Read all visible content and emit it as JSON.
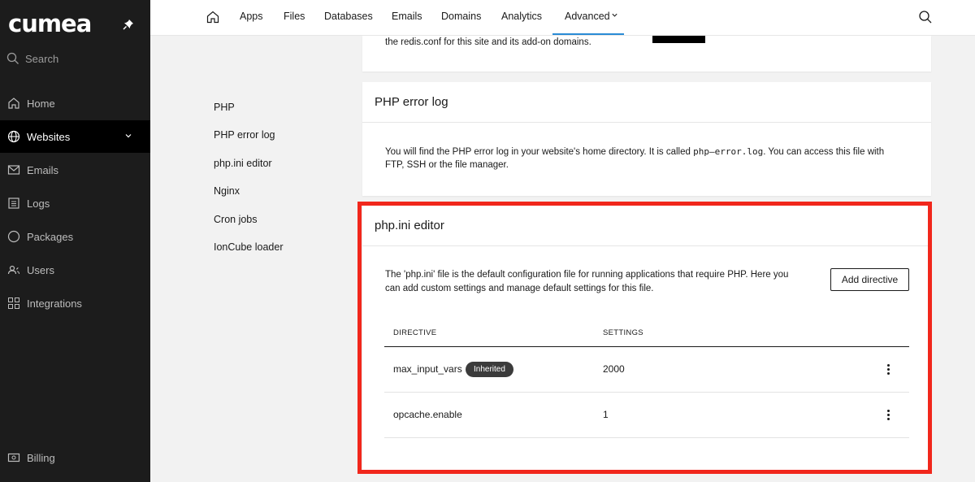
{
  "app": {
    "logo": "cumea"
  },
  "sidebar": {
    "search_label": "Search",
    "items": [
      {
        "label": "Home",
        "icon": "home-icon"
      },
      {
        "label": "Websites",
        "icon": "globe-icon",
        "active": true
      },
      {
        "label": "Emails",
        "icon": "mail-icon"
      },
      {
        "label": "Logs",
        "icon": "logs-icon"
      },
      {
        "label": "Packages",
        "icon": "circle-icon"
      },
      {
        "label": "Users",
        "icon": "users-icon"
      },
      {
        "label": "Integrations",
        "icon": "grid-icon"
      }
    ],
    "billing_label": "Billing"
  },
  "topnav": {
    "links": [
      "Apps",
      "Files",
      "Databases",
      "Emails",
      "Domains",
      "Analytics"
    ],
    "advanced_label": "Advanced"
  },
  "subnav": {
    "items": [
      "PHP",
      "PHP error log",
      "php.ini editor",
      "Nginx",
      "Cron jobs",
      "IonCube loader"
    ]
  },
  "redis_card": {
    "text": "the redis.conf for this site and its add-on domains."
  },
  "error_log_card": {
    "title": "PHP error log",
    "text_before": "You will find the PHP error log in your website's home directory. It is called ",
    "filename": "php–error.log",
    "text_after": ". You can access this file with",
    "text_line2": "FTP, SSH or the file manager."
  },
  "php_ini_card": {
    "title": "php.ini editor",
    "description_line1": "The 'php.ini' file is the default configuration file for running applications that require PHP. Here you",
    "description_line2": "can add custom settings and manage default settings for this file.",
    "add_button": "Add directive",
    "columns": {
      "directive": "DIRECTIVE",
      "settings": "SETTINGS"
    },
    "rows": [
      {
        "directive": "max_input_vars",
        "badge": "Inherited",
        "setting": "2000"
      },
      {
        "directive": "opcache.enable",
        "badge": "",
        "setting": "1"
      }
    ]
  },
  "colors": {
    "highlight": "#f1271c",
    "accent": "#2a8bd6",
    "sidebar_bg": "#1c1c1c"
  }
}
